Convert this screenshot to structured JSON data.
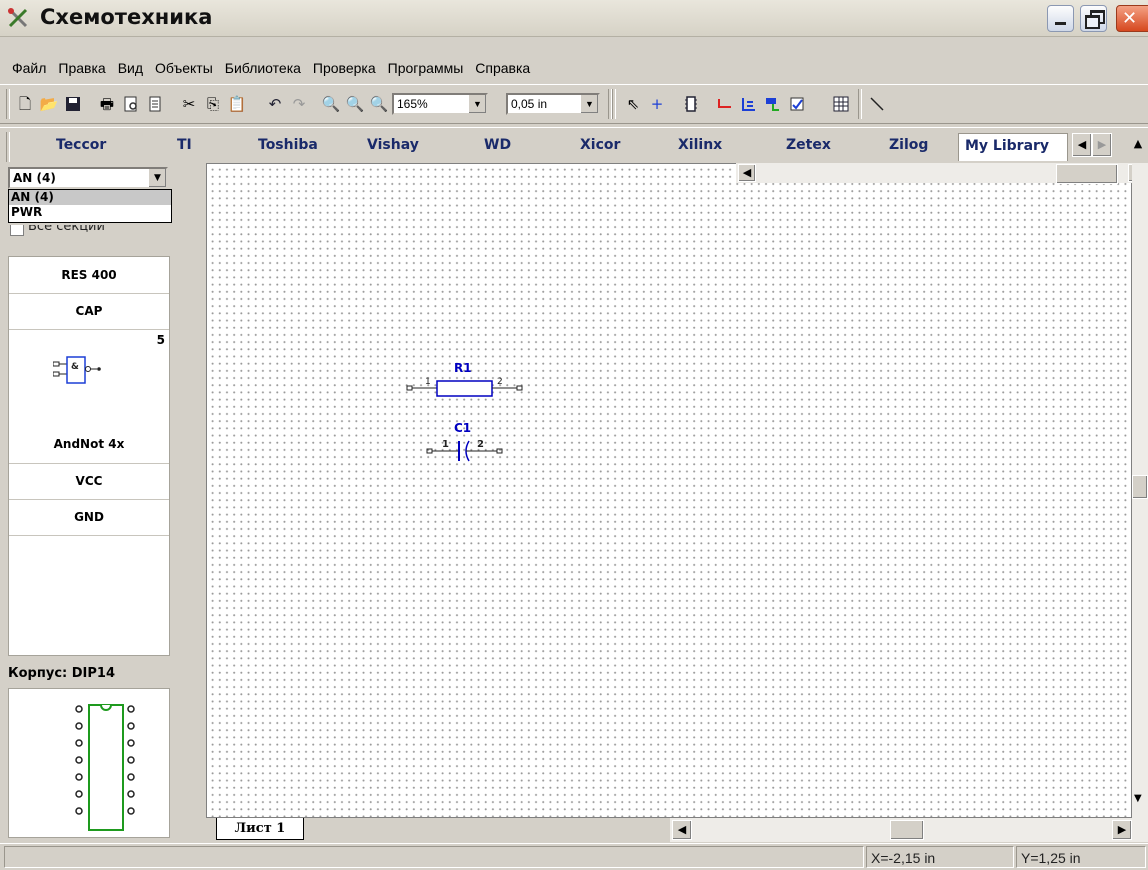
{
  "window": {
    "title": "Схемотехника"
  },
  "menu": [
    "Файл",
    "Правка",
    "Вид",
    "Объекты",
    "Библиотека",
    "Проверка",
    "Программы",
    "Справка"
  ],
  "toolbar": {
    "zoom_value": "165%",
    "grid_value": "0,05 in"
  },
  "library_tabs": [
    "Teccor",
    "TI",
    "Toshiba",
    "Vishay",
    "WD",
    "Xicor",
    "Xilinx",
    "Zetex",
    "Zilog",
    "My Library"
  ],
  "left_panel": {
    "section_select": "AN (4)",
    "section_options": [
      "AN (4)",
      "PWR"
    ],
    "all_sections_label": "Все секции",
    "components": [
      {
        "label": "RES 400"
      },
      {
        "label": "CAP"
      },
      {
        "label": "AndNot 4x",
        "count": "5",
        "gate_symbol": "&"
      },
      {
        "label": "VCC"
      },
      {
        "label": "GND"
      }
    ],
    "package_label": "Корпус: DIP14"
  },
  "schematic": {
    "r1": {
      "ref": "R1",
      "pin1": "1",
      "pin2": "2"
    },
    "c1": {
      "ref": "C1",
      "pin1": "1",
      "pin2": "2"
    }
  },
  "sheet_tab": "Лист 1",
  "status": {
    "x": "X=-2,15 in",
    "y": "Y=1,25 in"
  },
  "colors": {
    "component_blue": "#0000c0",
    "chip_green": "#1e9a1e",
    "title_blue": "#1a2a6a"
  }
}
